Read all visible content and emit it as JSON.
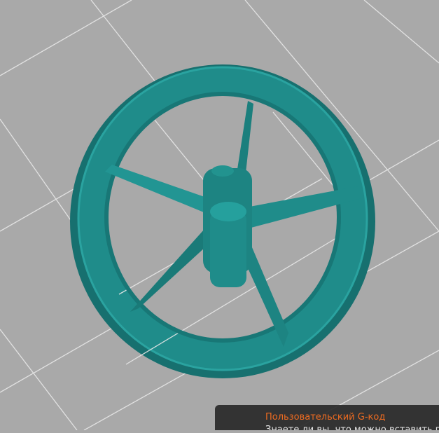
{
  "viewport": {
    "background_color": "#a9a9a9",
    "model_color": "#1e8a88",
    "grid_color": "#e8e8e8"
  },
  "hint": {
    "title": "Пользовательский G-код",
    "body": "Знаете ли вы, что можно вставить пол"
  }
}
